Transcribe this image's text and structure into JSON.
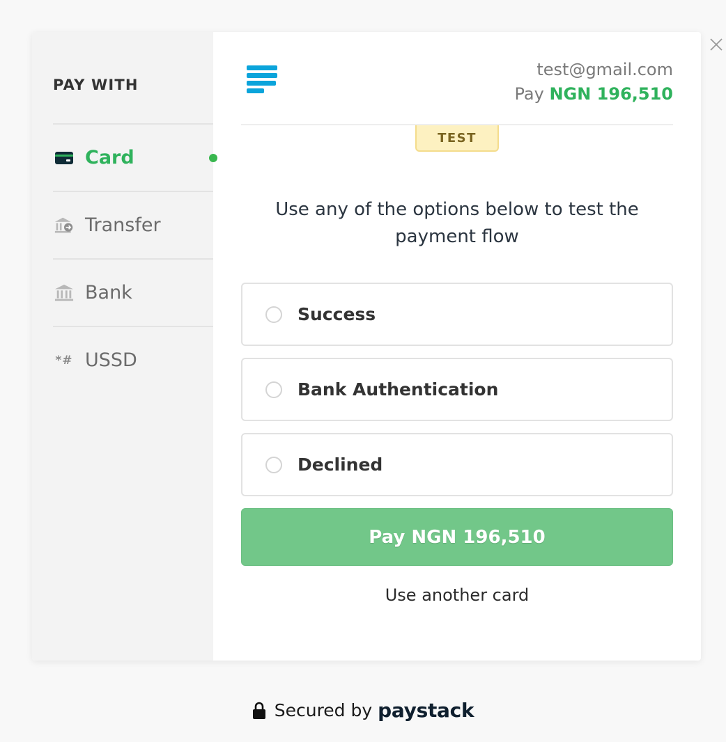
{
  "sidebar": {
    "heading": "PAY WITH",
    "methods": [
      {
        "label": "Card",
        "icon": "credit-card-icon"
      },
      {
        "label": "Transfer",
        "icon": "bank-transfer-icon"
      },
      {
        "label": "Bank",
        "icon": "bank-icon"
      },
      {
        "label": "USSD",
        "icon": "ussd-icon",
        "glyph": "*#"
      }
    ],
    "active_method": "Card"
  },
  "header": {
    "email": "test@gmail.com",
    "pay_prefix": "Pay",
    "amount": "NGN 196,510"
  },
  "badge": "TEST",
  "instruction": "Use any of the options below to test the payment flow",
  "options": [
    {
      "label": "Success"
    },
    {
      "label": "Bank Authentication"
    },
    {
      "label": "Declined"
    }
  ],
  "pay_button": "Pay NGN 196,510",
  "another_card": "Use another card",
  "footer": {
    "secured": "Secured by",
    "brand": "paystack"
  },
  "colors": {
    "accent_green": "#2fb25c",
    "button_green": "#72c789",
    "logo_blue": "#0ba4db",
    "test_badge_bg": "#fdf1c1"
  }
}
